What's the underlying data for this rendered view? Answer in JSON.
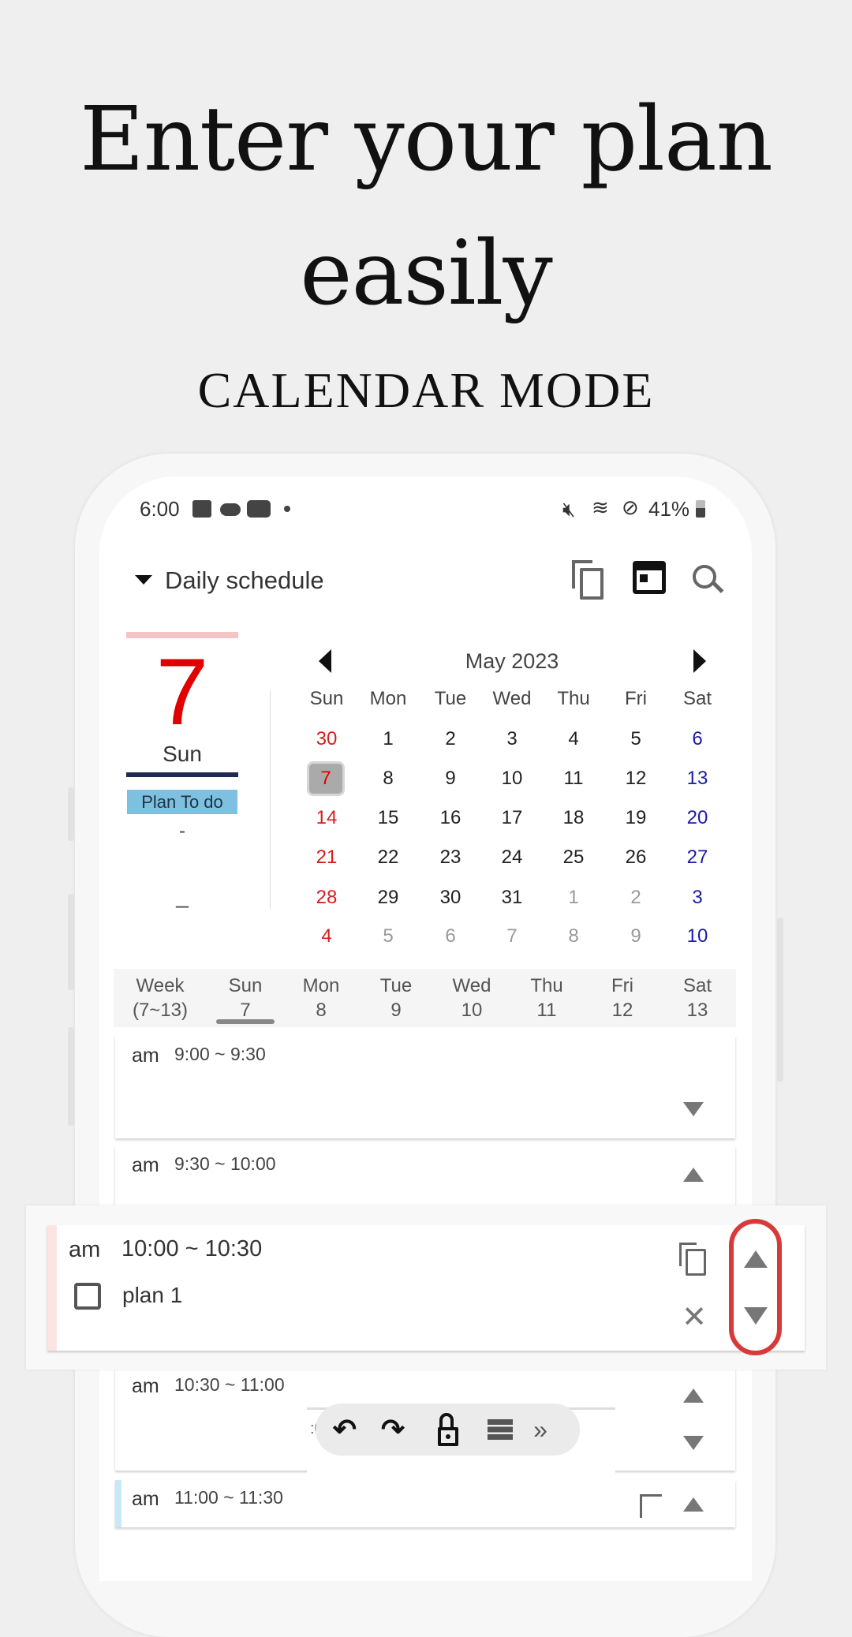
{
  "headline": {
    "line1": "Enter your plan",
    "line2": "easily",
    "subtitle": "CALENDAR MODE"
  },
  "status_bar": {
    "time": "6:00",
    "battery": "41%",
    "icons": [
      "image-icon",
      "cloud-icon",
      "youtube-icon",
      "dot-icon",
      "mute-icon",
      "wifi-icon",
      "block-icon",
      "battery-icon"
    ]
  },
  "header": {
    "title": "Daily schedule",
    "icons": [
      "copy-icon",
      "calendar-icon",
      "search-icon"
    ]
  },
  "day_panel": {
    "day": "7",
    "weekday": "Sun",
    "badge": "Plan To do",
    "line1": "-",
    "line2": "_"
  },
  "calendar": {
    "month": "May 2023",
    "weekdays": [
      "Sun",
      "Mon",
      "Tue",
      "Wed",
      "Thu",
      "Fri",
      "Sat"
    ],
    "selected": "7",
    "weeks": [
      [
        [
          "30",
          "sun"
        ],
        [
          "1",
          "cur"
        ],
        [
          "2",
          "cur"
        ],
        [
          "3",
          "cur"
        ],
        [
          "4",
          "cur"
        ],
        [
          "5",
          "cur"
        ],
        [
          "6",
          "sat"
        ]
      ],
      [
        [
          "7",
          "sun"
        ],
        [
          "8",
          "cur"
        ],
        [
          "9",
          "cur"
        ],
        [
          "10",
          "cur"
        ],
        [
          "11",
          "cur"
        ],
        [
          "12",
          "cur"
        ],
        [
          "13",
          "sat"
        ]
      ],
      [
        [
          "14",
          "sun"
        ],
        [
          "15",
          "cur"
        ],
        [
          "16",
          "cur"
        ],
        [
          "17",
          "cur"
        ],
        [
          "18",
          "cur"
        ],
        [
          "19",
          "cur"
        ],
        [
          "20",
          "sat"
        ]
      ],
      [
        [
          "21",
          "sun"
        ],
        [
          "22",
          "cur"
        ],
        [
          "23",
          "cur"
        ],
        [
          "24",
          "cur"
        ],
        [
          "25",
          "cur"
        ],
        [
          "26",
          "cur"
        ],
        [
          "27",
          "sat"
        ]
      ],
      [
        [
          "28",
          "sun"
        ],
        [
          "29",
          "cur"
        ],
        [
          "30",
          "cur"
        ],
        [
          "31",
          "cur"
        ],
        [
          "1",
          "other"
        ],
        [
          "2",
          "other"
        ],
        [
          "3",
          "sat"
        ]
      ],
      [
        [
          "4",
          "sun"
        ],
        [
          "5",
          "other"
        ],
        [
          "6",
          "other"
        ],
        [
          "7",
          "other"
        ],
        [
          "8",
          "other"
        ],
        [
          "9",
          "other"
        ],
        [
          "10",
          "sat"
        ]
      ]
    ]
  },
  "week_strip": [
    {
      "top": "Week",
      "bottom": "(7~13)"
    },
    {
      "top": "Sun",
      "bottom": "7"
    },
    {
      "top": "Mon",
      "bottom": "8"
    },
    {
      "top": "Tue",
      "bottom": "9"
    },
    {
      "top": "Wed",
      "bottom": "10"
    },
    {
      "top": "Thu",
      "bottom": "11"
    },
    {
      "top": "Fri",
      "bottom": "12"
    },
    {
      "top": "Sat",
      "bottom": "13"
    }
  ],
  "slots": [
    {
      "ampm": "am",
      "time": "9:00 ~ 9:30"
    },
    {
      "ampm": "am",
      "time": "9:30 ~ 10:00"
    },
    {
      "ampm": "am",
      "time": "10:00 ~ 10:30",
      "task": "plan 1"
    },
    {
      "ampm": "am",
      "time": "10:30 ~ 11:00"
    },
    {
      "ampm": "am",
      "time": "11:00 ~ 11:30"
    }
  ],
  "toolbar": {
    "partial": ":00",
    "icons": [
      "undo-icon",
      "redo-icon",
      "unlock-icon",
      "list-icon",
      "double-chevron-icon"
    ]
  },
  "colors": {
    "sunday": "#d81b1b",
    "saturday": "#1a1aa8",
    "other": "#999999",
    "accent_red": "#e03030",
    "badge": "#7ec0e0",
    "navy": "#1e2a50"
  }
}
